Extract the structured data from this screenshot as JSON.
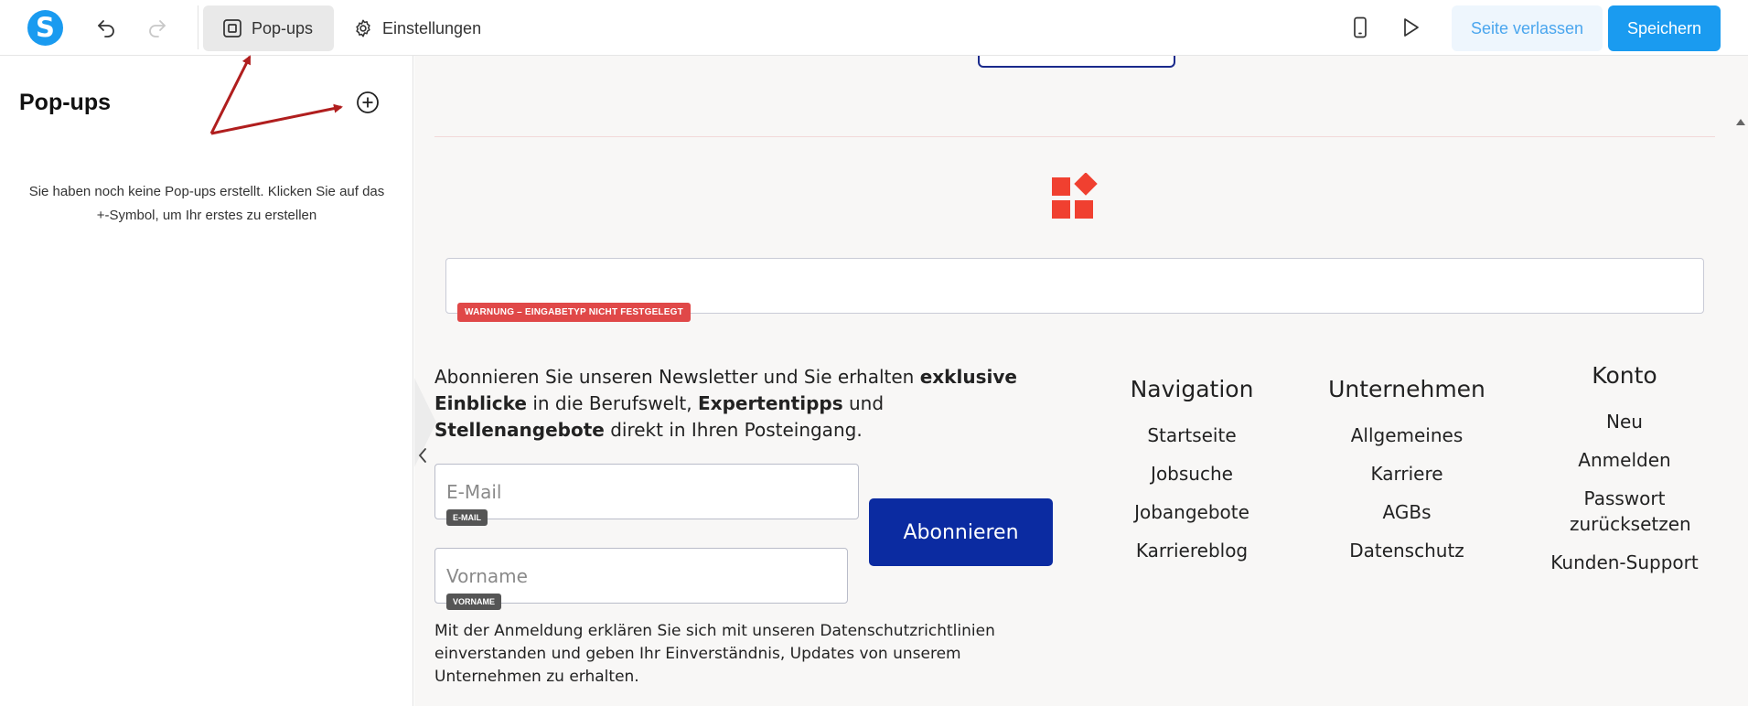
{
  "toolbar": {
    "logo_letter": "S",
    "tab_popups": "Pop-ups",
    "tab_settings": "Einstellungen",
    "leave_label": "Seite verlassen",
    "save_label": "Speichern"
  },
  "sidebar": {
    "title": "Pop-ups",
    "empty_line1": "Sie haben noch keine Pop-ups erstellt. Klicken Sie auf das",
    "empty_line2": "+-Symbol, um Ihr erstes zu erstellen"
  },
  "canvas": {
    "warning_badge": "WARNUNG – EINGABETYP NICHT FESTGELEGT",
    "newsletter": {
      "t1": "Abonnieren Sie unseren Newsletter und Sie erhalten ",
      "b1": "exklusive Einblicke",
      "t2": " in die Berufswelt, ",
      "b2": "Expertentipps",
      "t3": " und ",
      "b3": "Stellenangebote",
      "t4": " direkt in Ihren Posteingang."
    },
    "email_placeholder": "E-Mail",
    "email_badge": "E-MAIL",
    "firstname_placeholder": "Vorname",
    "firstname_badge": "VORNAME",
    "subscribe_label": "Abonnieren",
    "consent_text": "Mit der Anmeldung erklären Sie sich mit unseren Datenschutzrichtlinien einverstanden und geben Ihr Einverständnis, Updates von unserem Unternehmen zu erhalten.",
    "columns": [
      {
        "title": "Navigation",
        "links": [
          "Startseite",
          "Jobsuche",
          "Jobangebote",
          "Karriereblog"
        ]
      },
      {
        "title": "Unternehmen",
        "links": [
          "Allgemeines",
          "Karriere",
          "AGBs",
          "Datenschutz"
        ]
      },
      {
        "title": "Konto",
        "links": [
          "Neu",
          "Anmelden",
          "Passwort zurücksetzen",
          "Kunden-Support"
        ]
      }
    ]
  },
  "colors": {
    "accent": "#1a9bf0",
    "subscribe_button": "#0b2ba1",
    "warning": "#e04848",
    "brand_mark": "#f04030",
    "annotation_arrow": "#b01e1e"
  },
  "icons": {
    "undo": "undo-icon",
    "redo": "redo-icon",
    "popups": "popup-window-icon",
    "settings": "gear-icon",
    "device": "mobile-device-icon",
    "preview": "play-icon",
    "add": "plus-circle-icon",
    "collapse": "chevron-left-icon"
  }
}
